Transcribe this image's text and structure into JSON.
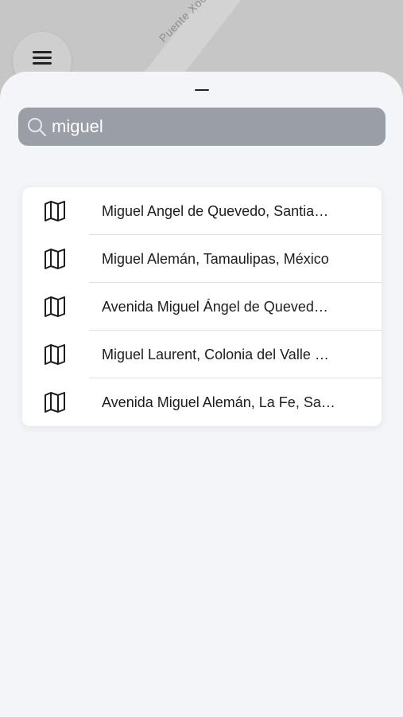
{
  "map": {
    "street_label": "Puente Xoco"
  },
  "search": {
    "value": "miguel"
  },
  "results": [
    {
      "label": "Miguel Angel de Quevedo, Santia…"
    },
    {
      "label": "Miguel Alemán, Tamaulipas, México"
    },
    {
      "label": "Avenida Miguel Ángel de Queved…"
    },
    {
      "label": "Miguel Laurent, Colonia del Valle …"
    },
    {
      "label": "Avenida Miguel Alemán, La Fe, Sa…"
    }
  ]
}
